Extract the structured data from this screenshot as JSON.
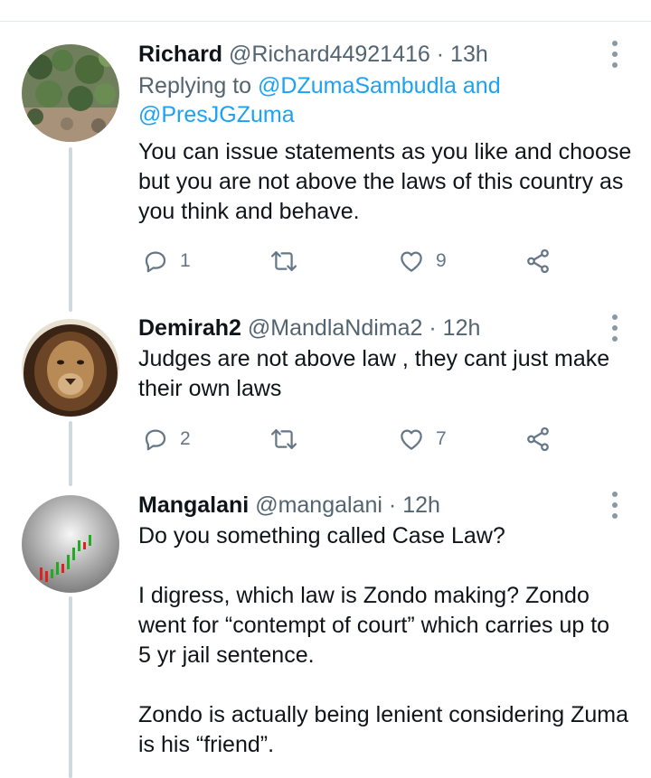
{
  "tweets": [
    {
      "name": "Richard",
      "handle": "@Richard44921416",
      "dot": "·",
      "time": "13h",
      "replying_prefix": "Replying to ",
      "replying_user1": "@DZumaSambudla",
      "replying_and": " and",
      "replying_user2": "@PresJGZuma",
      "text_lines": [
        "You can issue statements as you like and choose",
        "but you are not above the laws of this country as",
        "you think and behave."
      ],
      "reply_count": "1",
      "retweet_count": "",
      "like_count": "9"
    },
    {
      "name": "Demirah2",
      "handle": "@MandlaNdima2",
      "dot": "·",
      "time": "12h",
      "text_lines": [
        "Judges are not above law , they cant just make",
        "their own laws"
      ],
      "reply_count": "2",
      "retweet_count": "",
      "like_count": "7"
    },
    {
      "name": "Mangalani",
      "handle": "@mangalani",
      "dot": "·",
      "time": "12h",
      "text_lines": [
        "Do you something called Case Law?",
        "",
        "I digress, which law is Zondo making? Zondo",
        "went for “contempt of court” which carries up to",
        "5 yr jail sentence.",
        "",
        "Zondo is actually being lenient considering Zuma",
        "is his “friend”."
      ]
    }
  ],
  "icons": {
    "reply": "reply-icon",
    "retweet": "retweet-icon",
    "like": "heart-icon",
    "share": "share-icon",
    "more": "more-vertical-icon"
  },
  "colors": {
    "link": "#1da1f2",
    "secondary_text": "#536471",
    "icon": "#657786",
    "thread_line": "#cfd9de"
  }
}
